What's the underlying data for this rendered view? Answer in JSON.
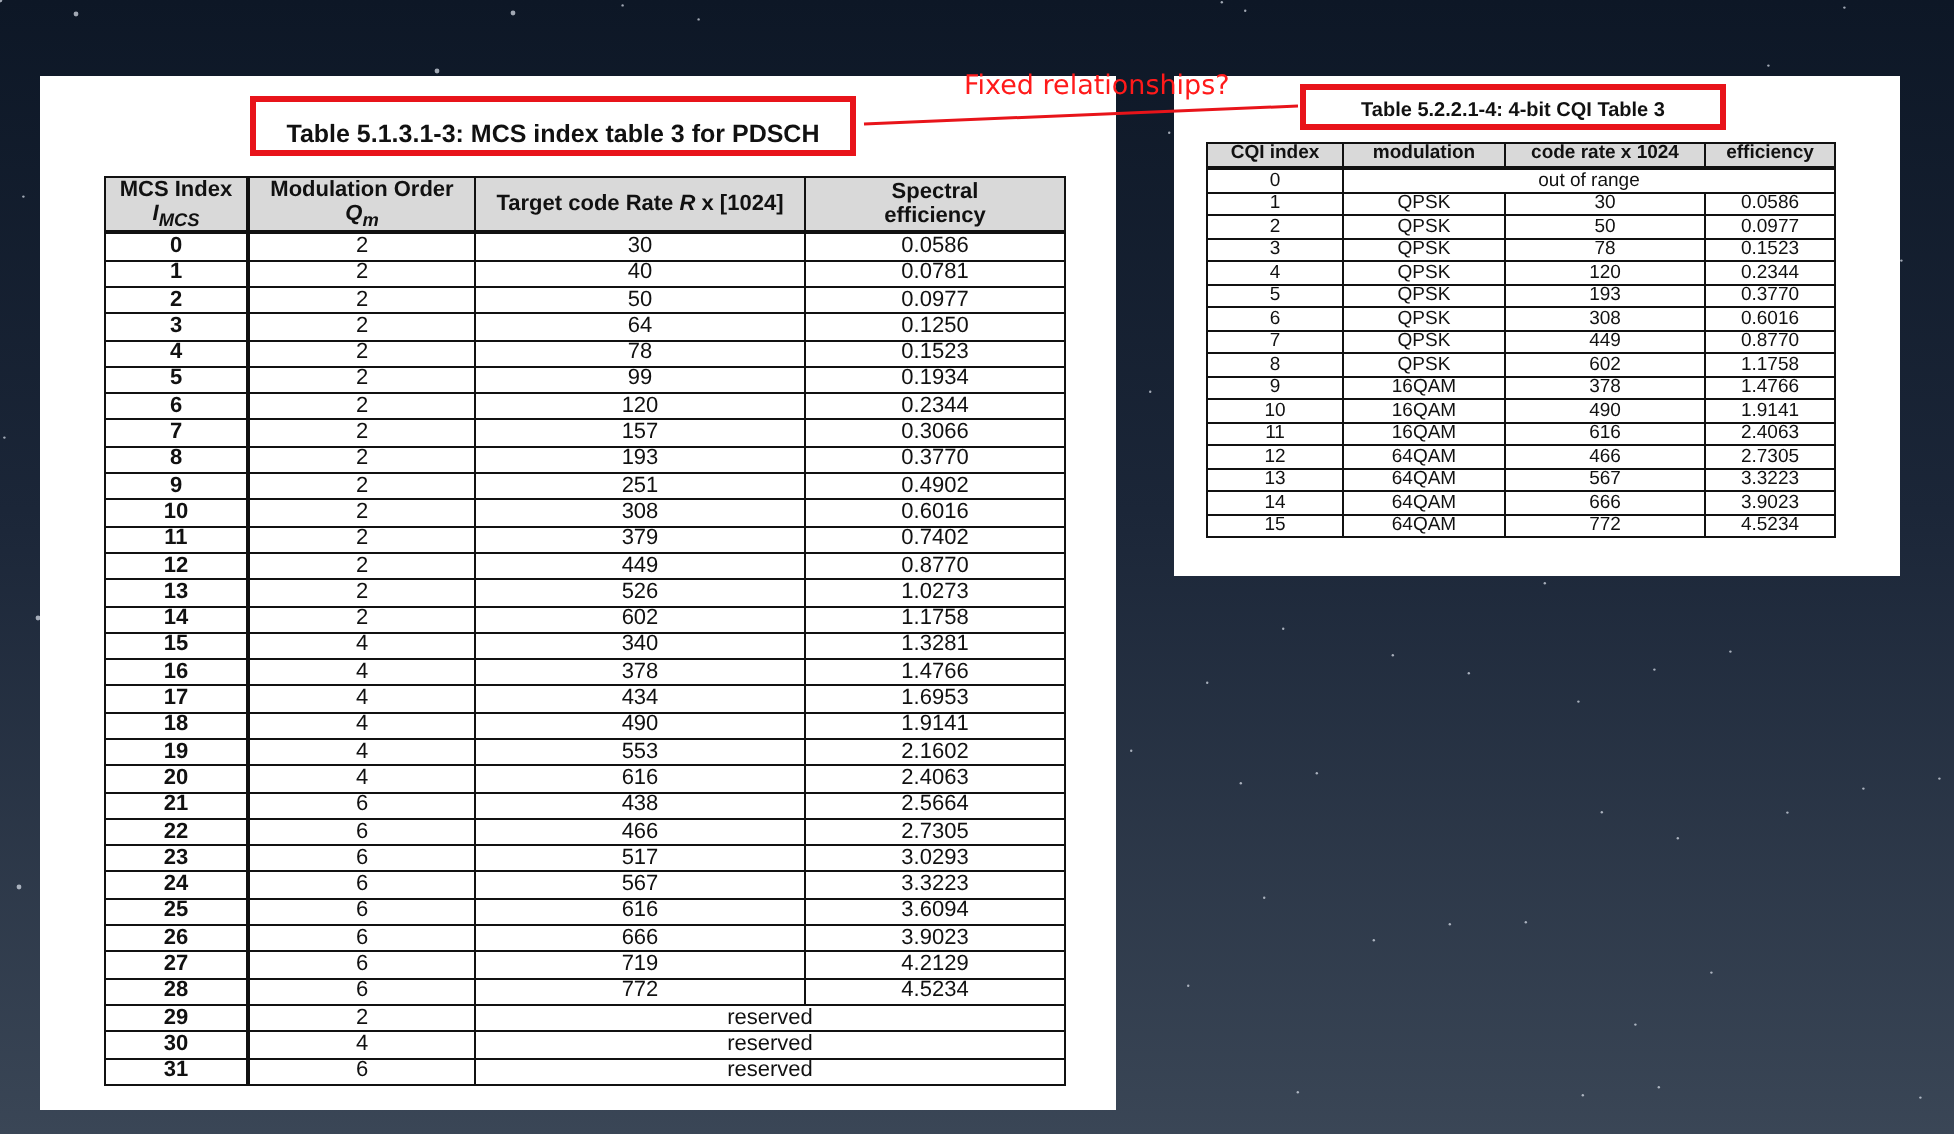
{
  "annotation": {
    "text": "Fixed relationships?"
  },
  "mcs_table": {
    "title": "Table 5.1.3.1-3: MCS index table 3 for PDSCH",
    "columns": [
      {
        "line1": "MCS Index",
        "line2": "I$_{MCS}$"
      },
      {
        "line1": "Modulation Order",
        "line2": "Q$_{m}$"
      },
      {
        "line1": "Target code Rate *R* x [1024]"
      },
      {
        "line1": "Spectral",
        "line2": "efficiency"
      }
    ],
    "rows": [
      {
        "kind": "value",
        "index": "0",
        "order": "2",
        "rate": "30",
        "efficiency": "0.0586"
      },
      {
        "kind": "value",
        "index": "1",
        "order": "2",
        "rate": "40",
        "efficiency": "0.0781"
      },
      {
        "kind": "value",
        "index": "2",
        "order": "2",
        "rate": "50",
        "efficiency": "0.0977"
      },
      {
        "kind": "value",
        "index": "3",
        "order": "2",
        "rate": "64",
        "efficiency": "0.1250"
      },
      {
        "kind": "value",
        "index": "4",
        "order": "2",
        "rate": "78",
        "efficiency": "0.1523"
      },
      {
        "kind": "value",
        "index": "5",
        "order": "2",
        "rate": "99",
        "efficiency": "0.1934"
      },
      {
        "kind": "value",
        "index": "6",
        "order": "2",
        "rate": "120",
        "efficiency": "0.2344"
      },
      {
        "kind": "value",
        "index": "7",
        "order": "2",
        "rate": "157",
        "efficiency": "0.3066"
      },
      {
        "kind": "value",
        "index": "8",
        "order": "2",
        "rate": "193",
        "efficiency": "0.3770"
      },
      {
        "kind": "value",
        "index": "9",
        "order": "2",
        "rate": "251",
        "efficiency": "0.4902"
      },
      {
        "kind": "value",
        "index": "10",
        "order": "2",
        "rate": "308",
        "efficiency": "0.6016"
      },
      {
        "kind": "value",
        "index": "11",
        "order": "2",
        "rate": "379",
        "efficiency": "0.7402"
      },
      {
        "kind": "value",
        "index": "12",
        "order": "2",
        "rate": "449",
        "efficiency": "0.8770"
      },
      {
        "kind": "value",
        "index": "13",
        "order": "2",
        "rate": "526",
        "efficiency": "1.0273"
      },
      {
        "kind": "value",
        "index": "14",
        "order": "2",
        "rate": "602",
        "efficiency": "1.1758"
      },
      {
        "kind": "value",
        "index": "15",
        "order": "4",
        "rate": "340",
        "efficiency": "1.3281"
      },
      {
        "kind": "value",
        "index": "16",
        "order": "4",
        "rate": "378",
        "efficiency": "1.4766"
      },
      {
        "kind": "value",
        "index": "17",
        "order": "4",
        "rate": "434",
        "efficiency": "1.6953"
      },
      {
        "kind": "value",
        "index": "18",
        "order": "4",
        "rate": "490",
        "efficiency": "1.9141"
      },
      {
        "kind": "value",
        "index": "19",
        "order": "4",
        "rate": "553",
        "efficiency": "2.1602"
      },
      {
        "kind": "value",
        "index": "20",
        "order": "4",
        "rate": "616",
        "efficiency": "2.4063"
      },
      {
        "kind": "value",
        "index": "21",
        "order": "6",
        "rate": "438",
        "efficiency": "2.5664"
      },
      {
        "kind": "value",
        "index": "22",
        "order": "6",
        "rate": "466",
        "efficiency": "2.7305"
      },
      {
        "kind": "value",
        "index": "23",
        "order": "6",
        "rate": "517",
        "efficiency": "3.0293"
      },
      {
        "kind": "value",
        "index": "24",
        "order": "6",
        "rate": "567",
        "efficiency": "3.3223"
      },
      {
        "kind": "value",
        "index": "25",
        "order": "6",
        "rate": "616",
        "efficiency": "3.6094"
      },
      {
        "kind": "value",
        "index": "26",
        "order": "6",
        "rate": "666",
        "efficiency": "3.9023"
      },
      {
        "kind": "value",
        "index": "27",
        "order": "6",
        "rate": "719",
        "efficiency": "4.2129"
      },
      {
        "kind": "value",
        "index": "28",
        "order": "6",
        "rate": "772",
        "efficiency": "4.5234"
      },
      {
        "kind": "reserved",
        "index": "29",
        "order": "2",
        "note": "reserved"
      },
      {
        "kind": "reserved",
        "index": "30",
        "order": "4",
        "note": "reserved"
      },
      {
        "kind": "reserved",
        "index": "31",
        "order": "6",
        "note": "reserved"
      }
    ]
  },
  "cqi_table": {
    "title": "Table 5.2.2.1-4: 4-bit CQI Table 3",
    "columns": [
      "CQI index",
      "modulation",
      "code rate x 1024",
      "efficiency"
    ],
    "rows": [
      {
        "kind": "out_of_range",
        "index": "0",
        "note": "out of range"
      },
      {
        "kind": "value",
        "index": "1",
        "modulation": "QPSK",
        "rate": "30",
        "efficiency": "0.0586"
      },
      {
        "kind": "value",
        "index": "2",
        "modulation": "QPSK",
        "rate": "50",
        "efficiency": "0.0977"
      },
      {
        "kind": "value",
        "index": "3",
        "modulation": "QPSK",
        "rate": "78",
        "efficiency": "0.1523"
      },
      {
        "kind": "value",
        "index": "4",
        "modulation": "QPSK",
        "rate": "120",
        "efficiency": "0.2344"
      },
      {
        "kind": "value",
        "index": "5",
        "modulation": "QPSK",
        "rate": "193",
        "efficiency": "0.3770"
      },
      {
        "kind": "value",
        "index": "6",
        "modulation": "QPSK",
        "rate": "308",
        "efficiency": "0.6016"
      },
      {
        "kind": "value",
        "index": "7",
        "modulation": "QPSK",
        "rate": "449",
        "efficiency": "0.8770"
      },
      {
        "kind": "value",
        "index": "8",
        "modulation": "QPSK",
        "rate": "602",
        "efficiency": "1.1758"
      },
      {
        "kind": "value",
        "index": "9",
        "modulation": "16QAM",
        "rate": "378",
        "efficiency": "1.4766"
      },
      {
        "kind": "value",
        "index": "10",
        "modulation": "16QAM",
        "rate": "490",
        "efficiency": "1.9141"
      },
      {
        "kind": "value",
        "index": "11",
        "modulation": "16QAM",
        "rate": "616",
        "efficiency": "2.4063"
      },
      {
        "kind": "value",
        "index": "12",
        "modulation": "64QAM",
        "rate": "466",
        "efficiency": "2.7305"
      },
      {
        "kind": "value",
        "index": "13",
        "modulation": "64QAM",
        "rate": "567",
        "efficiency": "3.3223"
      },
      {
        "kind": "value",
        "index": "14",
        "modulation": "64QAM",
        "rate": "666",
        "efficiency": "3.9023"
      },
      {
        "kind": "value",
        "index": "15",
        "modulation": "64QAM",
        "rate": "772",
        "efficiency": "4.5234"
      }
    ]
  }
}
